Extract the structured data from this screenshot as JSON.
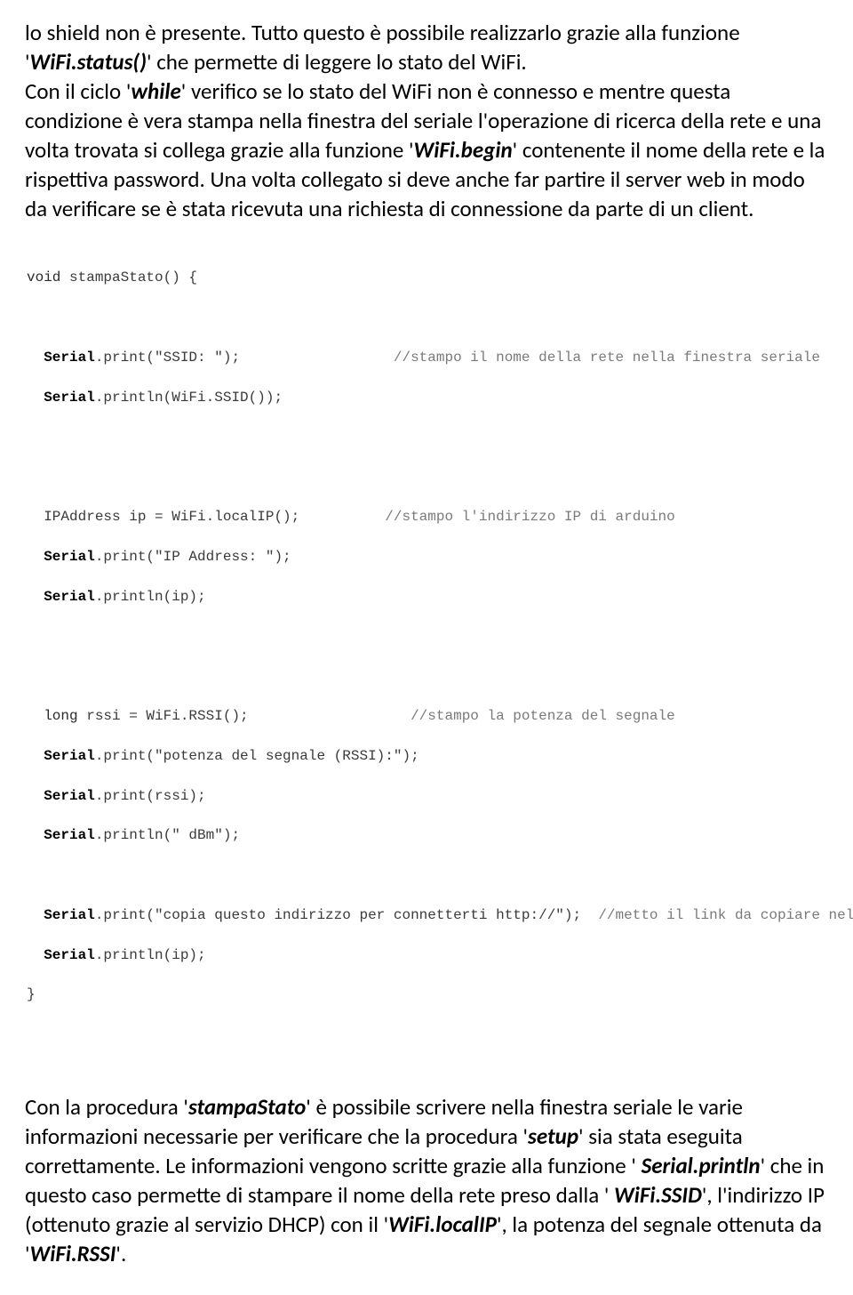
{
  "p1": {
    "t1": "lo shield non è presente. Tutto questo è possibile realizzarlo grazie alla funzione ",
    "q1": "'",
    "f1": "WiFi.status()",
    "q2": "'",
    "t2": " che permette di leggere lo stato del WiFi.",
    "t3": "Con il ciclo ",
    "q3": "'",
    "f2": "while",
    "q4": "'",
    "t4": " verifico se lo stato del WiFi non è connesso e mentre questa condizione è vera stampa nella finestra del seriale l'operazione di ricerca della rete e una volta trovata si collega grazie alla funzione ",
    "q5": "'",
    "f3": "WiFi.begin",
    "q6": "'",
    "t5": " contenente il nome della rete e la rispettiva password. Una volta collegato si deve anche far partire il server web in modo da verificare se è stata ricevuta una richiesta di connessione da parte di un client."
  },
  "code": {
    "l1a": "void",
    "l1b": " stampaStato() {",
    "l2a": "Serial",
    "l2b": ".print(\"SSID: \");",
    "l2c": "//stampo il nome della rete nella finestra seriale",
    "l3a": "Serial",
    "l3b": ".println(WiFi.SSID());",
    "l4a": "  IPAddress ip = WiFi.localIP();",
    "l4c": "//stampo l'indirizzo IP di arduino",
    "l5a": "Serial",
    "l5b": ".print(\"IP Address: \");",
    "l6a": "Serial",
    "l6b": ".println(ip);",
    "l7a": "long",
    "l7b": " rssi = WiFi.RSSI();",
    "l7c": "//stampo la potenza del segnale",
    "l8a": "Serial",
    "l8b": ".print(\"potenza del segnale (RSSI):\");",
    "l9a": "Serial",
    "l9b": ".print(rssi);",
    "l10a": "Serial",
    "l10b": ".println(\" dBm\");",
    "l11a": "Serial",
    "l11b": ".print(\"copia questo indirizzo per connetterti http://\");",
    "l11c": "//metto il link da copiare nella pagina web",
    "l12a": "Serial",
    "l12b": ".println(ip);",
    "l13": "}"
  },
  "p2": {
    "t1": "Con la procedura ",
    "q1": "'",
    "f1": "stampaStato",
    "q2": "'",
    "t2": "  è possibile scrivere nella finestra  seriale le varie informazioni necessarie per verificare che la procedura ",
    "q3": "'",
    "f2": "setup",
    "q4": "'",
    "t3": " sia stata eseguita correttamente. Le informazioni vengono scritte grazie alla funzione ",
    "q5": "'",
    "sp": " ",
    "f3": "Serial.println",
    "q6": "'",
    "t4": "   che in questo caso permette di stampare il nome della rete preso dalla ",
    "q7": "'",
    "sp2": " ",
    "f4": "WiFi.SSID",
    "q8": "'",
    "t5": ", l'indirizzo IP (ottenuto grazie al servizio DHCP) con il ",
    "q9": "'",
    "f5": "WiFi.localIP",
    "q10": "'",
    "t6": ", la potenza del segnale ottenuta da ",
    "q11": "'",
    "f6": "WiFi.RSSI",
    "q12": "'",
    "t7": "."
  }
}
